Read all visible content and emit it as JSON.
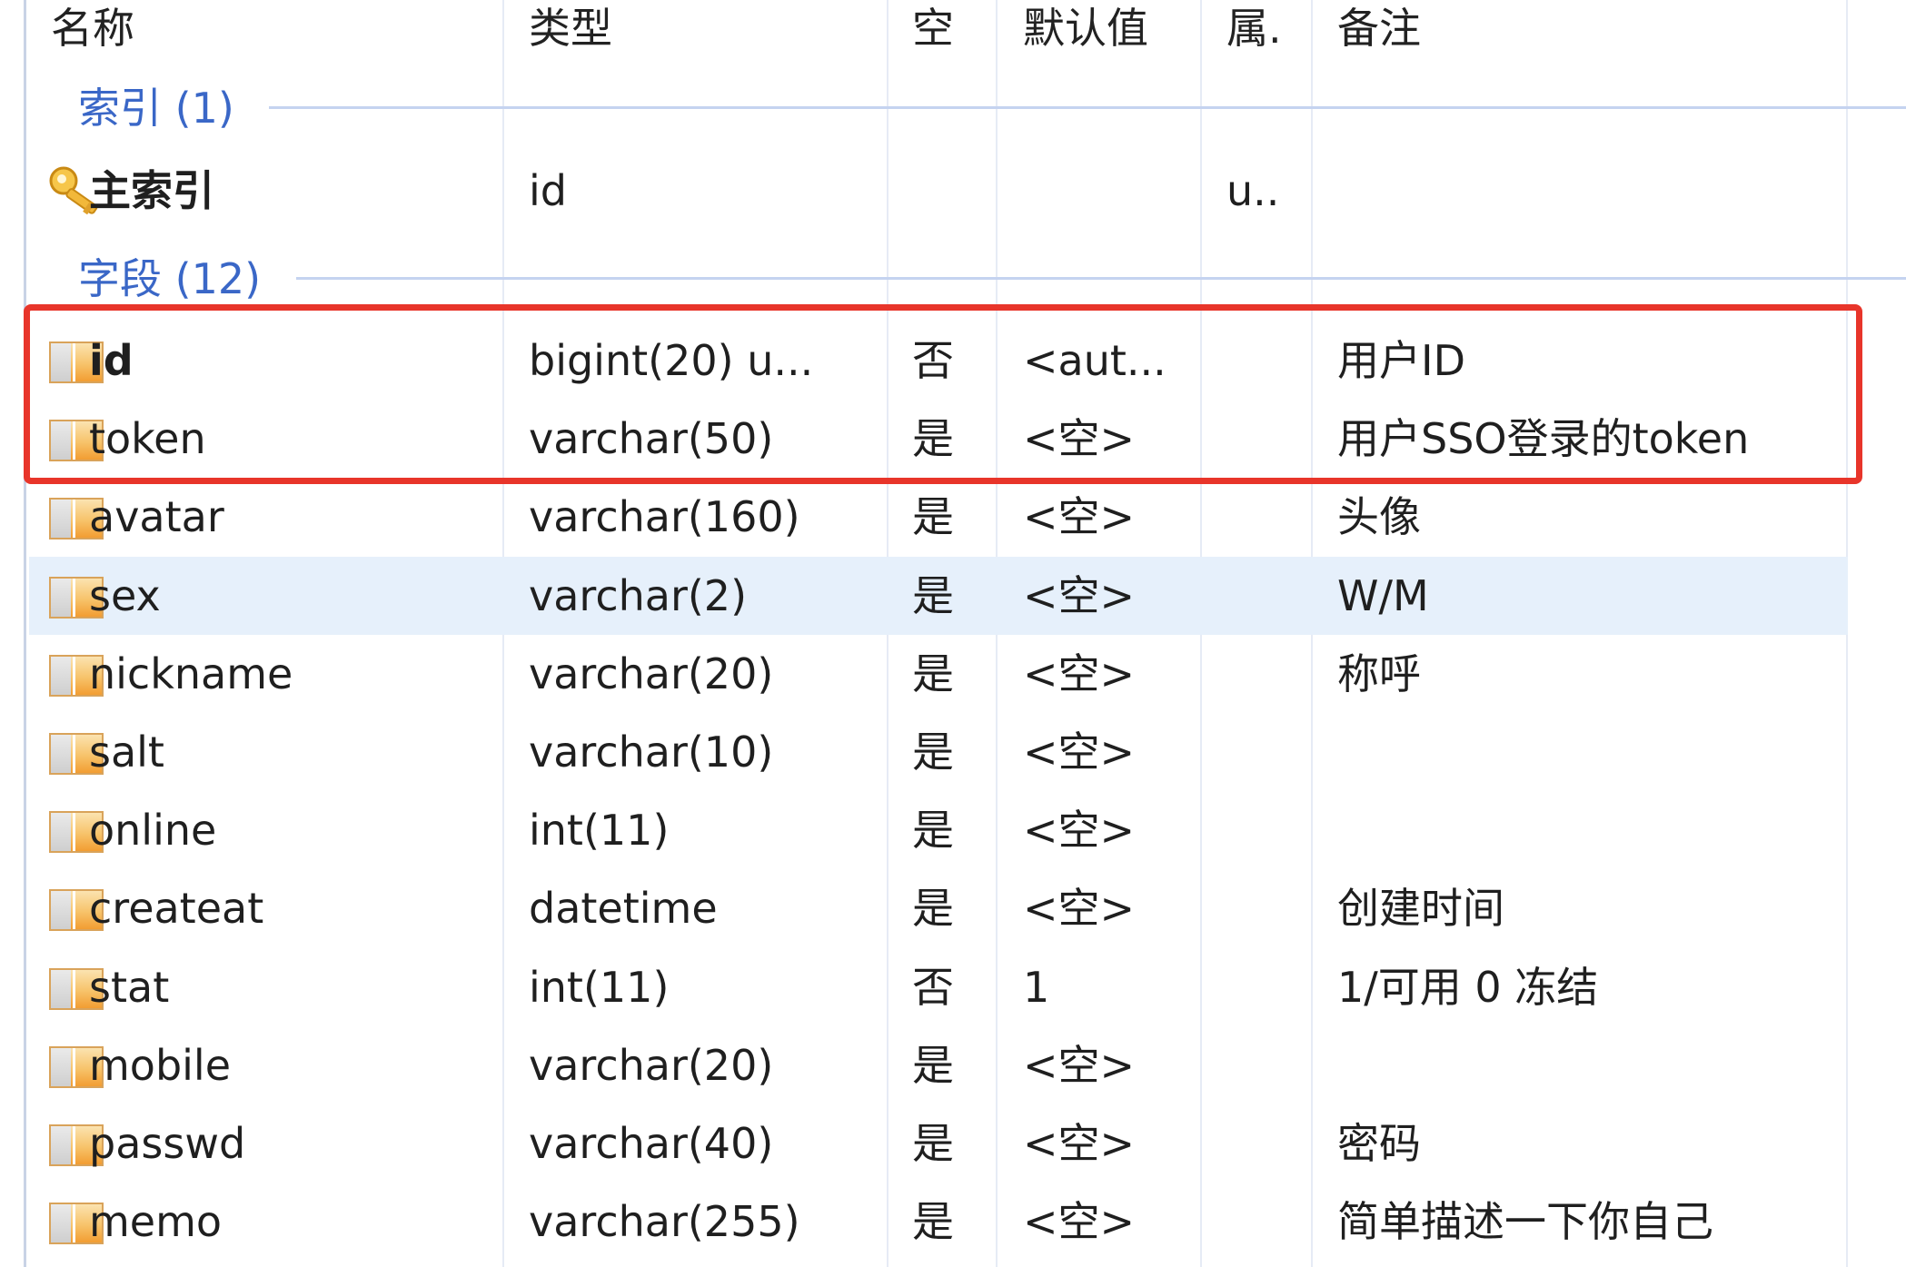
{
  "columns": {
    "name": "名称",
    "type": "类型",
    "null": "空",
    "default": "默认值",
    "attr": "属.",
    "comment": "备注"
  },
  "index_group": {
    "label": "索引 (1)",
    "rows": [
      {
        "icon": "key-icon",
        "name": "主索引",
        "type": "id",
        "null": "",
        "default": "",
        "attr": "u..",
        "comment": ""
      }
    ]
  },
  "field_group": {
    "label": "字段 (12)",
    "rows": [
      {
        "icon": "field-icon",
        "name": "id",
        "type": "bigint(20) u...",
        "null": "否",
        "default": "<aut...",
        "attr": "",
        "comment": "用户ID"
      },
      {
        "icon": "field-icon",
        "name": "token",
        "type": "varchar(50)",
        "null": "是",
        "default": "<空>",
        "attr": "",
        "comment": "用户SSO登录的token"
      },
      {
        "icon": "field-icon",
        "name": "avatar",
        "type": "varchar(160)",
        "null": "是",
        "default": "<空>",
        "attr": "",
        "comment": "头像"
      },
      {
        "icon": "field-icon",
        "name": "sex",
        "type": "varchar(2)",
        "null": "是",
        "default": "<空>",
        "attr": "",
        "comment": "W/M"
      },
      {
        "icon": "field-icon",
        "name": "nickname",
        "type": "varchar(20)",
        "null": "是",
        "default": "<空>",
        "attr": "",
        "comment": "称呼"
      },
      {
        "icon": "field-icon",
        "name": "salt",
        "type": "varchar(10)",
        "null": "是",
        "default": "<空>",
        "attr": "",
        "comment": ""
      },
      {
        "icon": "field-icon",
        "name": "online",
        "type": "int(11)",
        "null": "是",
        "default": "<空>",
        "attr": "",
        "comment": ""
      },
      {
        "icon": "field-icon",
        "name": "createat",
        "type": "datetime",
        "null": "是",
        "default": "<空>",
        "attr": "",
        "comment": "创建时间"
      },
      {
        "icon": "field-icon",
        "name": "stat",
        "type": "int(11)",
        "null": "否",
        "default": "1",
        "attr": "",
        "comment": "1/可用 0 冻结"
      },
      {
        "icon": "field-icon",
        "name": "mobile",
        "type": "varchar(20)",
        "null": "是",
        "default": "<空>",
        "attr": "",
        "comment": ""
      },
      {
        "icon": "field-icon",
        "name": "passwd",
        "type": "varchar(40)",
        "null": "是",
        "default": "<空>",
        "attr": "",
        "comment": "密码"
      },
      {
        "icon": "field-icon",
        "name": "memo",
        "type": "varchar(255)",
        "null": "是",
        "default": "<空>",
        "attr": "",
        "comment": "简单描述一下你自己"
      }
    ],
    "selected_field": "sex",
    "highlighted_fields": [
      "id",
      "token"
    ]
  },
  "colors": {
    "group_label": "#3a67c7",
    "selected_row": "#e6f0fb",
    "highlight_border": "#e8352a"
  }
}
